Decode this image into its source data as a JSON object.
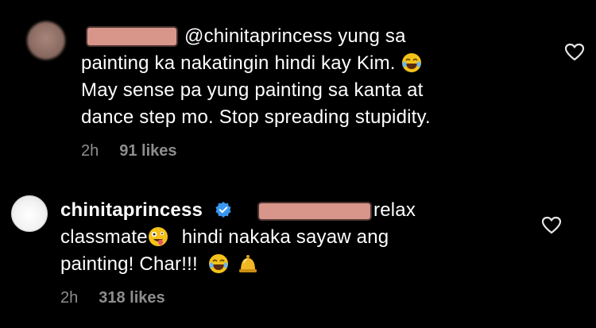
{
  "comments": [
    {
      "mention": "@chinitaprincess",
      "line1_rest": "yung sa",
      "line2": "painting ka nakatingin hindi kay Kim.",
      "line3": "May sense pa yung painting sa kanta at",
      "line4": "dance step mo. Stop spreading stupidity.",
      "time": "2h",
      "likes": "91 likes",
      "emoji1": "laughing-emoji"
    },
    {
      "username": "chinitaprincess",
      "after_redact": "relax",
      "line2a": "classmate",
      "line2b": "hindi nakaka sayaw ang",
      "line3": "painting! Char!!!",
      "time": "2h",
      "likes": "318 likes",
      "emoji1": "zany-face-emoji",
      "emoji2": "laughing-emoji",
      "emoji3": "bell-emoji"
    }
  ],
  "colors": {
    "background": "#000000",
    "text": "#ffffff",
    "meta": "#8e8e8e",
    "verified": "#3897f0",
    "redaction": "#d8958a"
  }
}
